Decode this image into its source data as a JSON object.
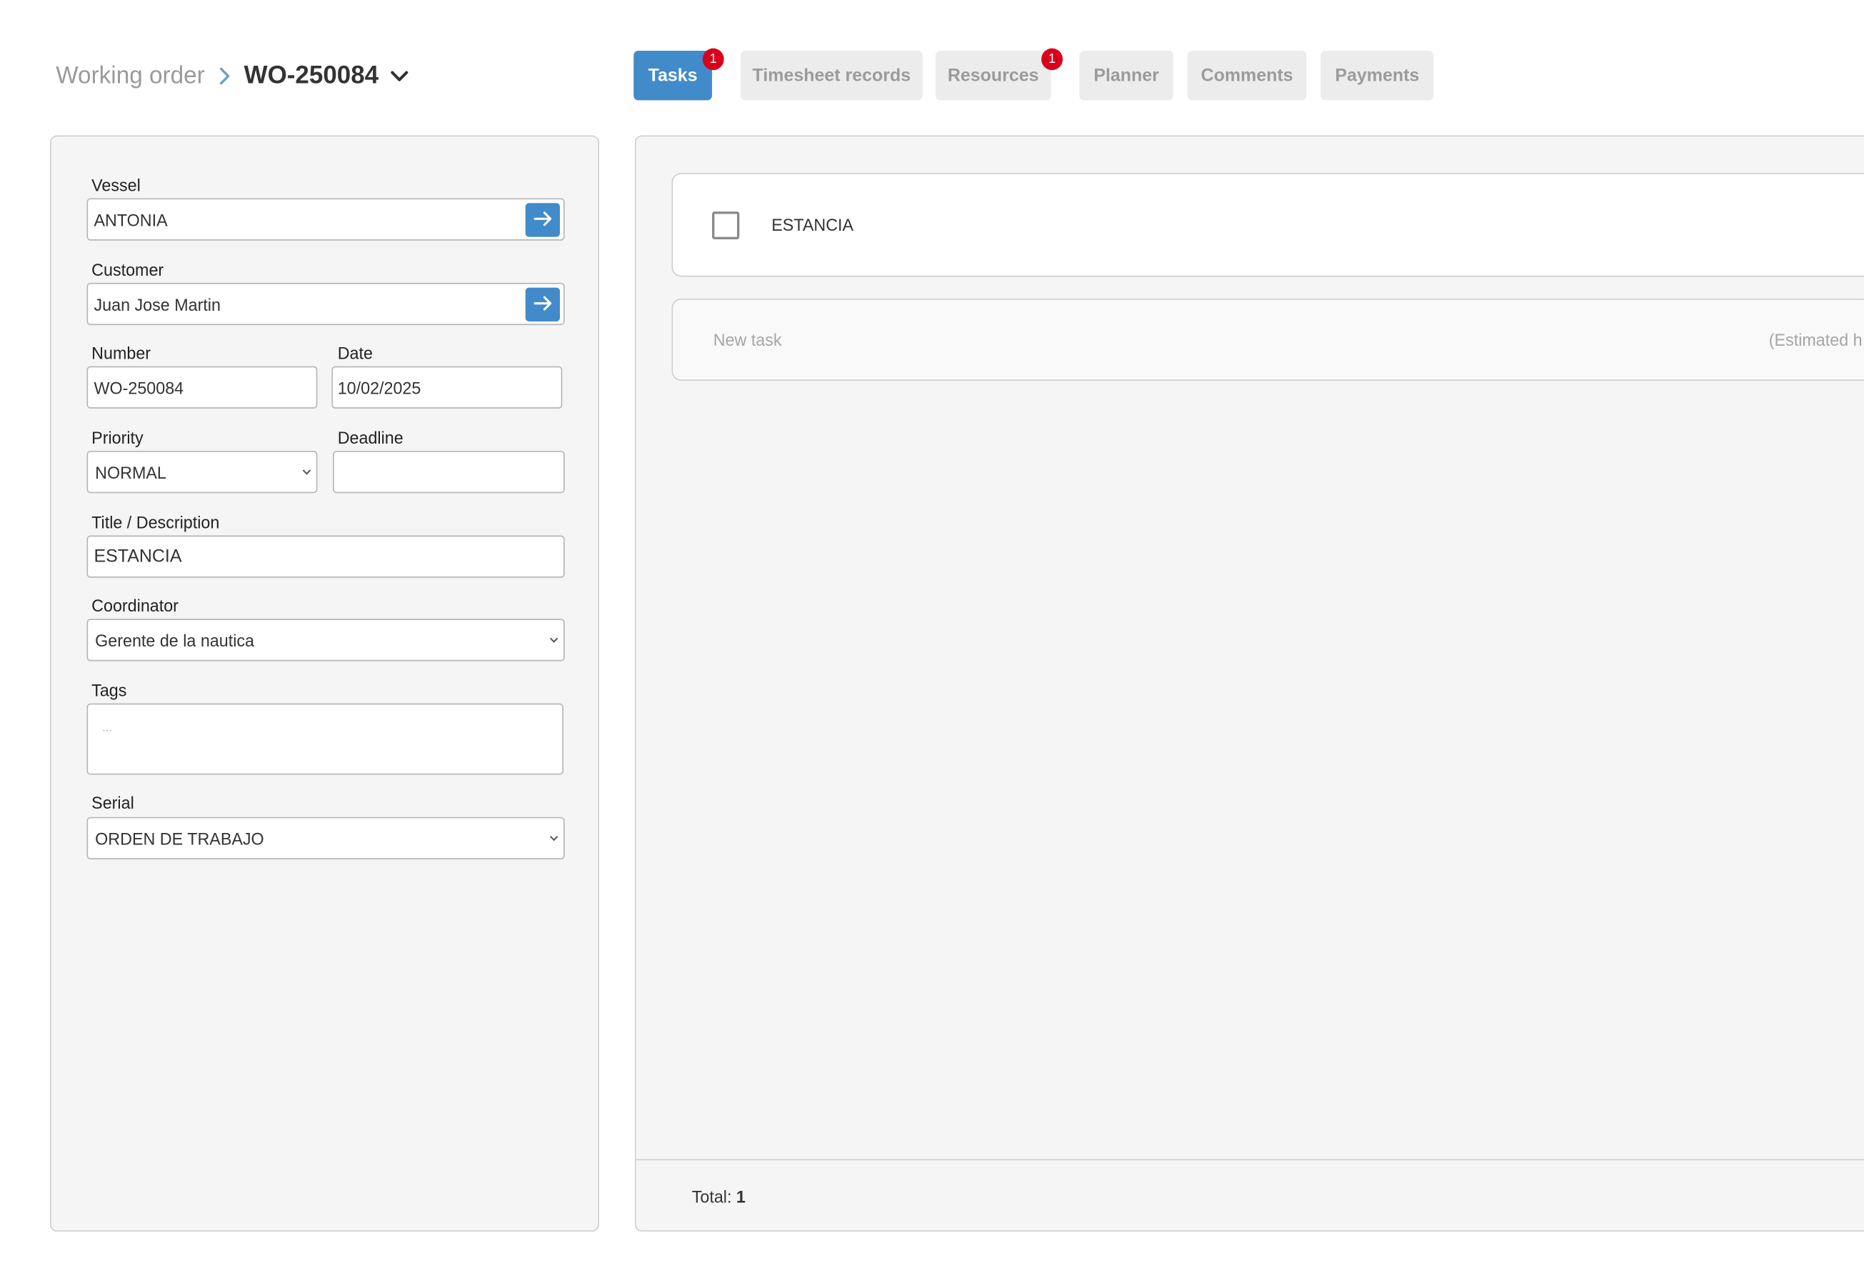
{
  "colors": {
    "primary": "#428bca",
    "badge": "#d9001b",
    "tab_inactive_bg": "#ececec",
    "panel_bg": "#f5f5f5"
  },
  "breadcrumb": {
    "parent": "Working order",
    "separator_icon": "chevron-right-icon",
    "current": "WO-250084",
    "dropdown_icon": "chevron-down-icon"
  },
  "tabs": [
    {
      "label": "Tasks",
      "active": true,
      "badge": "1"
    },
    {
      "label": "Timesheet records",
      "active": false
    },
    {
      "label": "Resources",
      "active": false,
      "badge": "1"
    },
    {
      "label": "Planner",
      "active": false
    },
    {
      "label": "Comments",
      "active": false
    },
    {
      "label": "Payments",
      "active": false
    }
  ],
  "form": {
    "vessel": {
      "label": "Vessel",
      "value": "ANTONIA",
      "button_icon": "arrow-right-icon"
    },
    "customer": {
      "label": "Customer",
      "value": "Juan Jose Martin",
      "button_icon": "arrow-right-icon"
    },
    "number": {
      "label": "Number",
      "value": "WO-250084"
    },
    "date": {
      "label": "Date",
      "value": "10/02/2025"
    },
    "priority": {
      "label": "Priority",
      "value": "NORMAL"
    },
    "deadline": {
      "label": "Deadline",
      "value": ""
    },
    "title": {
      "label": "Title / Description",
      "value": "ESTANCIA"
    },
    "coordinator": {
      "label": "Coordinator",
      "value": "Gerente de la nautica"
    },
    "tags": {
      "label": "Tags",
      "placeholder": "..."
    },
    "serial": {
      "label": "Serial",
      "value": "ORDEN DE TRABAJO"
    }
  },
  "tasks": {
    "items": [
      {
        "label": "ESTANCIA",
        "checked": false
      }
    ],
    "new_task_placeholder": "New task",
    "estimated_hours_placeholder": "(Estimated h",
    "total_label": "Total:",
    "total_value": "1"
  }
}
